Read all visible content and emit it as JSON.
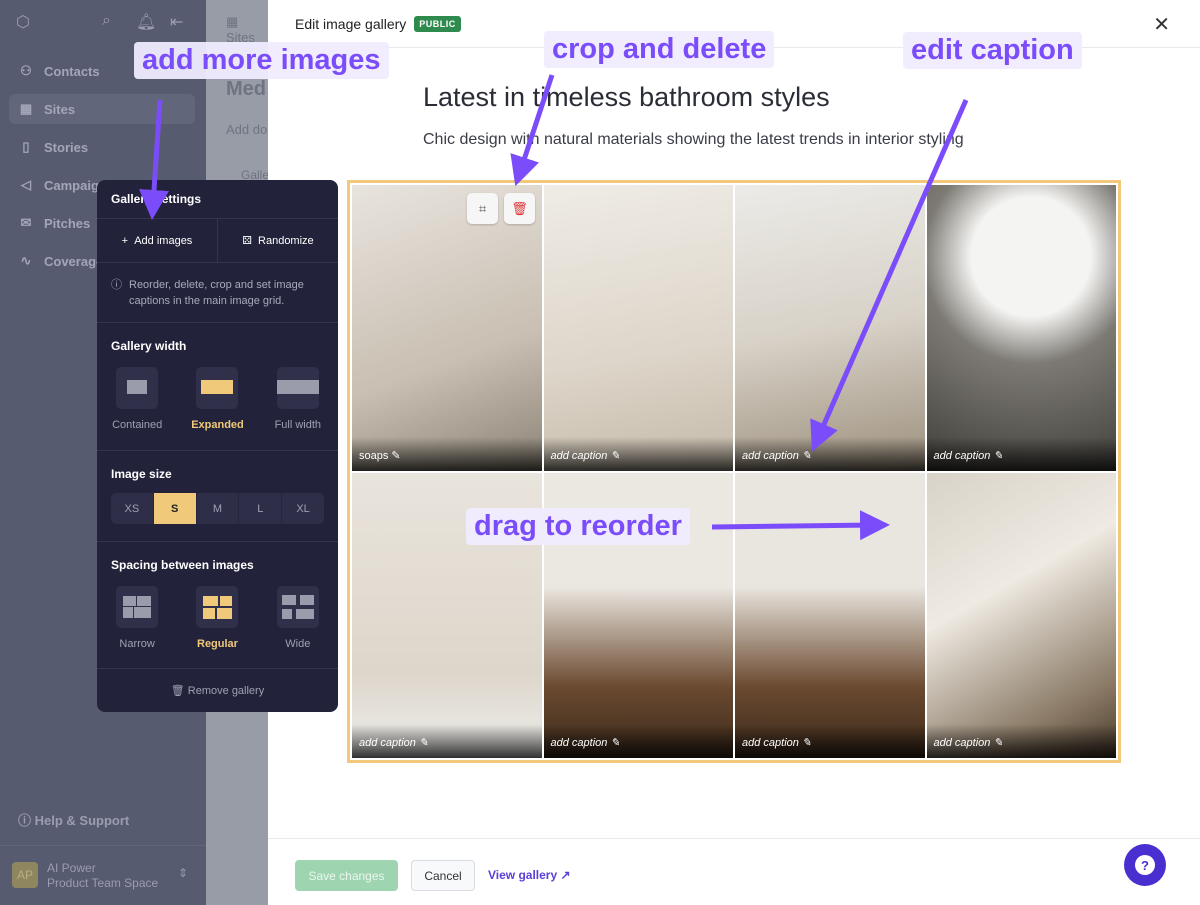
{
  "sidebar": {
    "items": [
      {
        "label": "Contacts",
        "icon": "user-icon"
      },
      {
        "label": "Sites",
        "icon": "grid-icon",
        "active": true
      },
      {
        "label": "Stories",
        "icon": "book-icon"
      },
      {
        "label": "Campaigns",
        "icon": "megaphone-icon"
      },
      {
        "label": "Pitches",
        "icon": "mail-icon"
      },
      {
        "label": "Coverage",
        "icon": "pulse-icon"
      }
    ],
    "help": "Help & Support",
    "space": {
      "initials": "AP",
      "name": "AI Power",
      "team": "Product Team Space"
    }
  },
  "background_page": {
    "breadcrumb": "Sites",
    "title": "Med",
    "add": "Add do",
    "gallery": "Galle"
  },
  "modal": {
    "title": "Edit image gallery",
    "badge": "PUBLIC",
    "gallery_title": "Latest in timeless bathroom styles",
    "gallery_subtitle": "Chic design with natural materials showing the latest trends in interior styling",
    "images": [
      {
        "caption": "soaps",
        "set": true
      },
      {
        "caption": "add caption"
      },
      {
        "caption": "add caption"
      },
      {
        "caption": "add caption"
      },
      {
        "caption": "add caption"
      },
      {
        "caption": "add caption"
      },
      {
        "caption": "add caption"
      },
      {
        "caption": "add caption"
      }
    ],
    "footer": {
      "save": "Save changes",
      "cancel": "Cancel",
      "view": "View gallery"
    }
  },
  "panel": {
    "title": "Gallery settings",
    "add_images": "Add images",
    "randomize": "Randomize",
    "info": "Reorder, delete, crop and set image captions in the main image grid.",
    "width_heading": "Gallery width",
    "width_options": [
      "Contained",
      "Expanded",
      "Full width"
    ],
    "width_selected": "Expanded",
    "size_heading": "Image size",
    "sizes": [
      "XS",
      "S",
      "M",
      "L",
      "XL"
    ],
    "size_selected": "S",
    "spacing_heading": "Spacing between images",
    "spacing_options": [
      "Narrow",
      "Regular",
      "Wide"
    ],
    "spacing_selected": "Regular",
    "remove": "Remove gallery"
  },
  "annotations": {
    "add_more": "add more images",
    "crop_delete": "crop and delete",
    "edit_caption": "edit caption",
    "drag": "drag to reorder"
  },
  "colors": {
    "accent": "#7b4dfa",
    "selected": "#f0c97a",
    "save": "#9fd4b0",
    "badge": "#2f8a4e"
  }
}
